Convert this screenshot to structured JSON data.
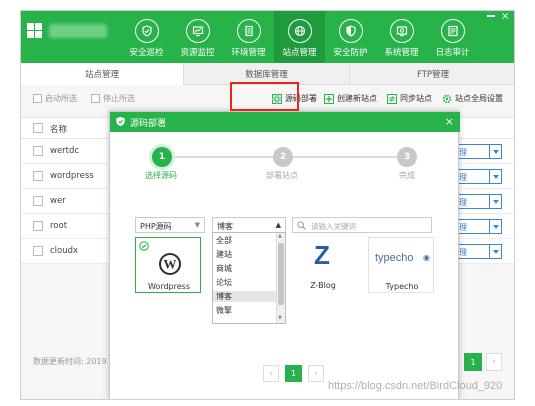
{
  "header": {
    "nav": [
      {
        "label": "安全巡检",
        "icon": "shield-check-icon"
      },
      {
        "label": "资源监控",
        "icon": "monitor-gauge-icon"
      },
      {
        "label": "环境管理",
        "icon": "server-rack-icon"
      },
      {
        "label": "站点管理",
        "icon": "globe-icon"
      },
      {
        "label": "安全防护",
        "icon": "shield-half-icon"
      },
      {
        "label": "系统管理",
        "icon": "gear-icon"
      },
      {
        "label": "日志审计",
        "icon": "log-list-icon"
      }
    ],
    "active_index": 3,
    "close_glyph": "×"
  },
  "tabs": [
    {
      "label": "站点管理"
    },
    {
      "label": "数据库管理"
    },
    {
      "label": "FTP管理"
    }
  ],
  "toolbar": {
    "start_selected": "启动所选",
    "stop_selected": "停止所选",
    "source_deploy": "源码部署",
    "create_site": "创建新站点",
    "sync_sites": "同步站点",
    "global_settings": "站点全局设置"
  },
  "list": {
    "name_header": "名称",
    "rows": [
      {
        "name": "wertdc",
        "action": "理"
      },
      {
        "name": "wordpress",
        "action": "理"
      },
      {
        "name": "wer",
        "action": "理"
      },
      {
        "name": "root",
        "action": "理"
      },
      {
        "name": "cloudx",
        "action": "理"
      }
    ],
    "footer": "数据更新时间: 2019",
    "current_page": "1",
    "next_glyph": "›"
  },
  "modal": {
    "title": "源码部署",
    "close_glyph": "×",
    "steps": [
      {
        "number": "1",
        "label": "选择源码"
      },
      {
        "number": "2",
        "label": "部署站点"
      },
      {
        "number": "3",
        "label": "完成"
      }
    ],
    "language_select": "PHP源码",
    "category_select": "博客",
    "search_placeholder": "请输入关键词",
    "dropdown_options": [
      "全部",
      "建站",
      "商城",
      "论坛",
      "博客",
      "微擎"
    ],
    "dropdown_selected_index": 4,
    "cards": [
      {
        "label": "Wordpress",
        "logo": "wordpress-logo-icon"
      },
      {
        "label": "Z-Blog",
        "logo": "zblog-logo-icon",
        "logo_text": "Z"
      },
      {
        "label": "Typecho",
        "logo": "typecho-logo-icon",
        "logo_text": "typecho"
      }
    ],
    "pager": {
      "prev": "‹",
      "page": "1",
      "next": "›"
    }
  },
  "watermark": "https://blog.csdn.net/BirdCloud_920",
  "colors": {
    "brand_green": "#27b24a",
    "highlight_red": "#e8261c",
    "link_blue": "#3b87d4"
  }
}
